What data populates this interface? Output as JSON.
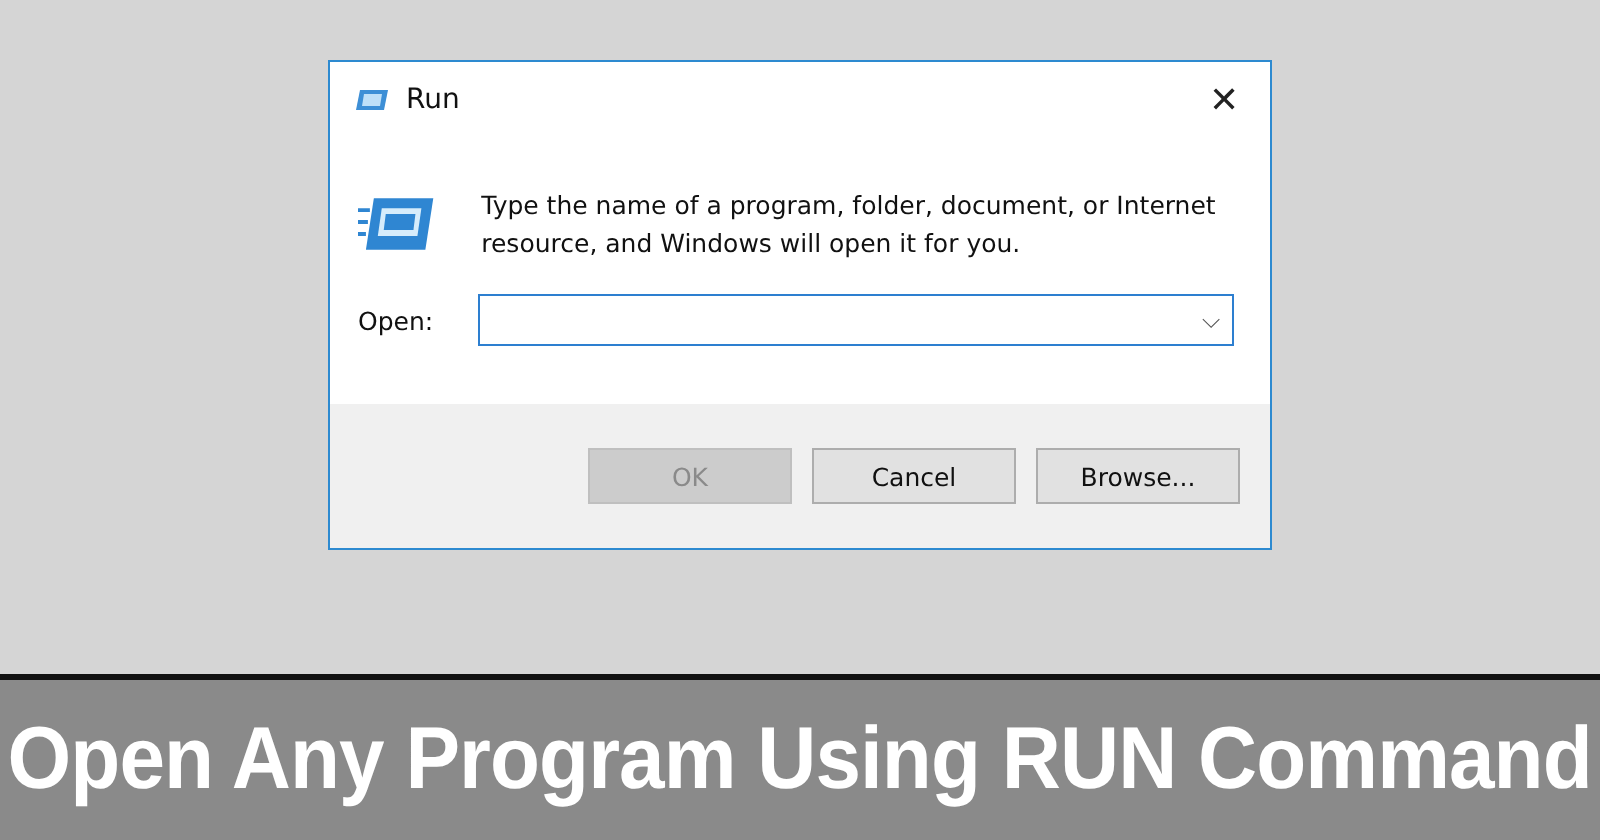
{
  "dialog": {
    "title": "Run",
    "close": "✕",
    "message": "Type the name of a program, folder, document, or Internet resource, and Windows will open it for you.",
    "open_label": "Open:",
    "open_field": {
      "dropdown": "⌵"
    },
    "buttons": [
      {
        "label": "OK",
        "disabled": true
      },
      {
        "label": "Cancel",
        "disabled": false
      },
      {
        "label": "Browse...",
        "disabled": false
      }
    ]
  },
  "banner": {
    "caption": "Open Any Program Using RUN Command"
  }
}
